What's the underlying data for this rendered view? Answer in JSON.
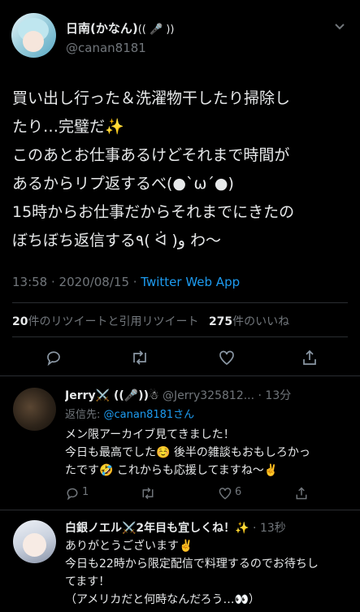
{
  "main_tweet": {
    "author_name": "日南(かなん)",
    "author_deco": "(( 🎤 ))",
    "handle": "@canan8181",
    "lines": [
      "買い出し行った＆洗濯物干したり掃除し",
      "たり…完璧だ✨",
      "このあとお仕事あるけどそれまで時間が",
      "あるからリプ返するべ(●`ω´●)",
      "15時からお仕事だからそれまでにきたの",
      "ぼちぼち返信する٩( ᐛ )و わ〜"
    ],
    "timestamp": "13:58 · 2020/08/15 · ",
    "source": "Twitter Web App",
    "retweet_count": "20",
    "retweet_label": "件のリツイートと引用リツイート",
    "like_count": "275",
    "like_label": "件のいいね"
  },
  "reply1": {
    "author_name": "Jerry⚔️ ((🎤))☃",
    "handle_time": "@Jerry325812... · 13分",
    "reply_to_label": "返信先: ",
    "reply_to_handle": "@canan8181さん",
    "lines": [
      "メン限アーカイブ見てきました！",
      "今日も最高でした☺️ 後半の雑談もおもしろかっ",
      "たです🤣 これからも応援してますね〜✌️"
    ],
    "reply_count": "1",
    "like_count": "6"
  },
  "reply2": {
    "author_name": "白銀ノエル⚔️2年目も宜しくね！✨",
    "time": " · 13秒",
    "lines": [
      "ありがとうございます✌️",
      "今日も22時から限定配信で料理するのでお待ちし",
      "てます！",
      "（アメリカだと何時なんだろう…👀）"
    ]
  },
  "colors": {
    "accent": "#1d9bf0",
    "muted": "#71767b",
    "text": "#d9d9d9",
    "background": "#000000"
  },
  "icons": [
    "chevron-down-icon",
    "reply-icon",
    "retweet-icon",
    "like-icon",
    "share-icon",
    "more-icon"
  ]
}
